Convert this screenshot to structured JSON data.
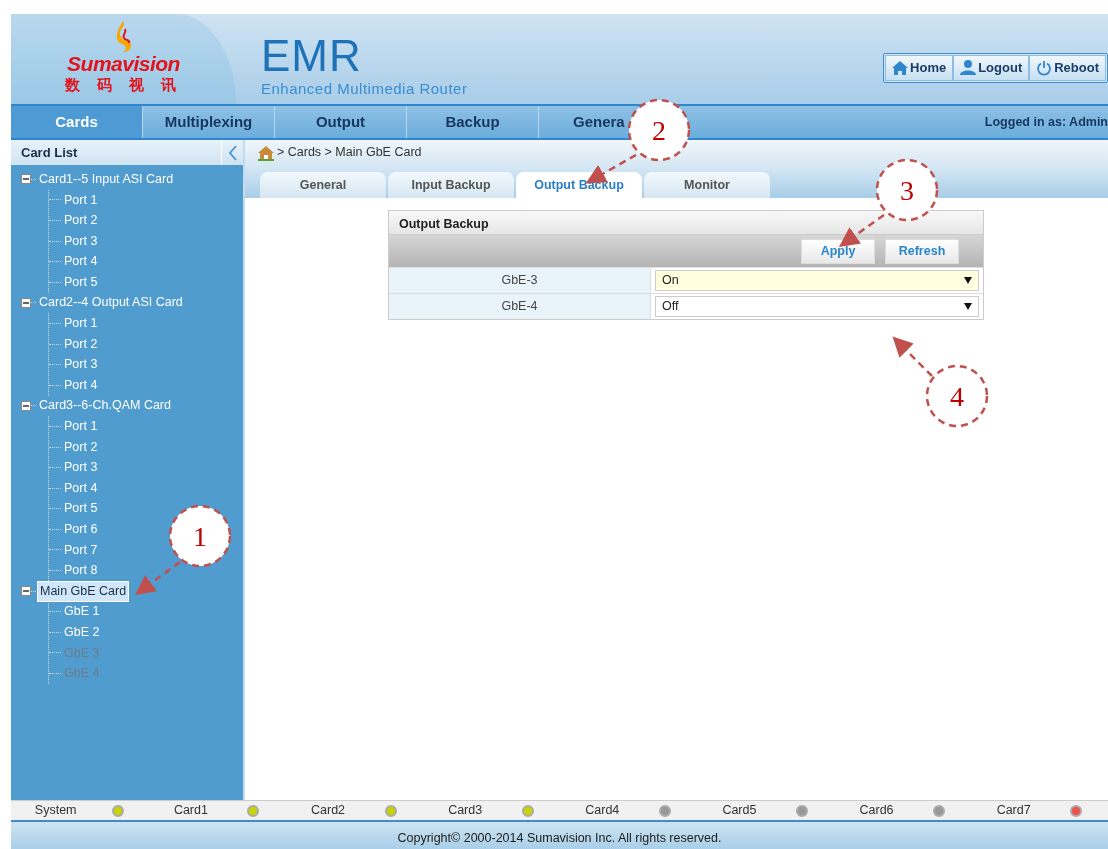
{
  "header": {
    "brand_latin": "Sumavision",
    "brand_chinese": "数 码 视 讯",
    "product": "EMR",
    "product_subtitle": "Enhanced Multimedia Router",
    "buttons": [
      {
        "label": "Home",
        "kind": "home"
      },
      {
        "label": "Logout",
        "kind": "user"
      },
      {
        "label": "Reboot",
        "kind": "power"
      }
    ]
  },
  "nav": {
    "tabs": [
      {
        "label": "Cards",
        "selected": true
      },
      {
        "label": "Multiplexing",
        "selected": false
      },
      {
        "label": "Output",
        "selected": false
      },
      {
        "label": "Backup",
        "selected": false
      },
      {
        "label": "Genera",
        "selected": false
      }
    ],
    "user_label": "Logged in as: Admin"
  },
  "sidebar": {
    "title": "Card List",
    "tree": [
      {
        "label": "Card1--5 Input ASI Card",
        "expanded": true,
        "selected": false,
        "disabled": false,
        "children": [
          {
            "label": "Port 1",
            "selected": false,
            "disabled": false
          },
          {
            "label": "Port 2",
            "selected": false,
            "disabled": false
          },
          {
            "label": "Port 3",
            "selected": false,
            "disabled": false
          },
          {
            "label": "Port 4",
            "selected": false,
            "disabled": false
          },
          {
            "label": "Port 5",
            "selected": false,
            "disabled": false
          }
        ]
      },
      {
        "label": "Card2--4 Output ASI Card",
        "expanded": true,
        "selected": false,
        "disabled": false,
        "children": [
          {
            "label": "Port 1",
            "selected": false,
            "disabled": false
          },
          {
            "label": "Port 2",
            "selected": false,
            "disabled": false
          },
          {
            "label": "Port 3",
            "selected": false,
            "disabled": false
          },
          {
            "label": "Port 4",
            "selected": false,
            "disabled": false
          }
        ]
      },
      {
        "label": "Card3--6-Ch.QAM Card",
        "expanded": true,
        "selected": false,
        "disabled": false,
        "children": [
          {
            "label": "Port 1",
            "selected": false,
            "disabled": false
          },
          {
            "label": "Port 2",
            "selected": false,
            "disabled": false
          },
          {
            "label": "Port 3",
            "selected": false,
            "disabled": false
          },
          {
            "label": "Port 4",
            "selected": false,
            "disabled": false
          },
          {
            "label": "Port 5",
            "selected": false,
            "disabled": false
          },
          {
            "label": "Port 6",
            "selected": false,
            "disabled": false
          },
          {
            "label": "Port 7",
            "selected": false,
            "disabled": false
          },
          {
            "label": "Port 8",
            "selected": false,
            "disabled": false
          }
        ]
      },
      {
        "label": "Main GbE Card",
        "expanded": true,
        "selected": true,
        "disabled": false,
        "children": [
          {
            "label": "GbE 1",
            "selected": false,
            "disabled": false
          },
          {
            "label": "GbE 2",
            "selected": false,
            "disabled": false
          },
          {
            "label": "GbE 3",
            "selected": false,
            "disabled": true
          },
          {
            "label": "GbE 4",
            "selected": false,
            "disabled": true
          }
        ]
      }
    ]
  },
  "breadcrumb": "> Cards > Main GbE Card",
  "sub_tabs": [
    {
      "label": "General",
      "selected": false
    },
    {
      "label": "Input Backup",
      "selected": false
    },
    {
      "label": "Output Backup",
      "selected": true
    },
    {
      "label": "Monitor",
      "selected": false
    }
  ],
  "panel": {
    "title": "Output Backup",
    "buttons": [
      "Apply",
      "Refresh"
    ],
    "rows": [
      {
        "label": "GbE-3",
        "value": "On",
        "focused": true
      },
      {
        "label": "GbE-4",
        "value": "Off",
        "focused": false
      }
    ]
  },
  "status_bar": [
    {
      "label": "System",
      "color": "#c8d400"
    },
    {
      "label": "Card1",
      "color": "#c8d400"
    },
    {
      "label": "Card2",
      "color": "#c8d400"
    },
    {
      "label": "Card3",
      "color": "#c8d400"
    },
    {
      "label": "Card4",
      "color": "#999999"
    },
    {
      "label": "Card5",
      "color": "#999999"
    },
    {
      "label": "Card6",
      "color": "#999999"
    },
    {
      "label": "Card7",
      "color": "#f0504a"
    }
  ],
  "footer": "Copyright© 2000-2014 Sumavision Inc. All rights reserved.",
  "callouts": [
    "1",
    "2",
    "3",
    "4"
  ]
}
